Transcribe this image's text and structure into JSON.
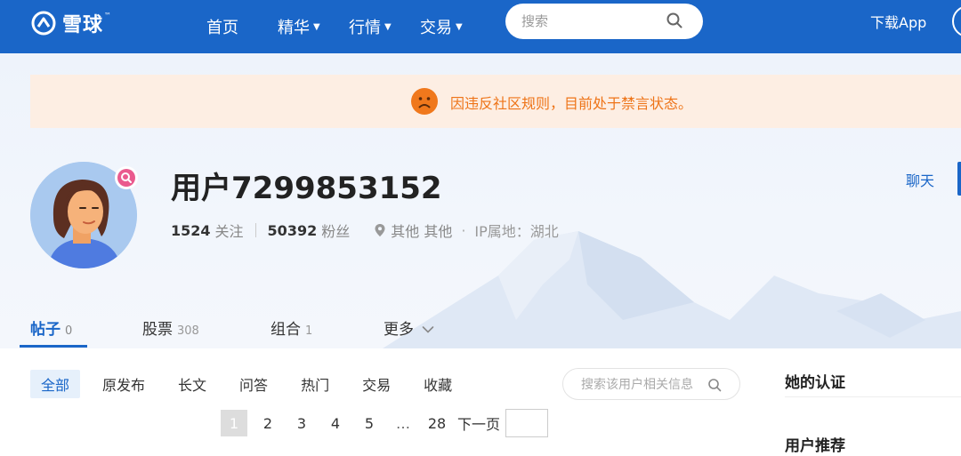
{
  "header": {
    "logo_text": "雪球",
    "logo_tm": "™",
    "nav": [
      {
        "label": "首页"
      },
      {
        "label": "精华"
      },
      {
        "label": "行情"
      },
      {
        "label": "交易"
      }
    ],
    "search_placeholder": "搜索",
    "download_label": "下载App"
  },
  "notice": {
    "text": "因违反社区规则，目前处于禁言状态。"
  },
  "profile": {
    "username": "用户7299853152",
    "following_count": "1524",
    "following_label": "关注",
    "followers_count": "50392",
    "followers_label": "粉丝",
    "location": "其他 其他",
    "ip_location": "IP属地：湖北",
    "chat_label": "聊天"
  },
  "tabs": [
    {
      "label": "帖子",
      "count": "0"
    },
    {
      "label": "股票",
      "count": "308"
    },
    {
      "label": "组合",
      "count": "1"
    },
    {
      "label": "更多",
      "count": ""
    }
  ],
  "filters": [
    "全部",
    "原发布",
    "长文",
    "问答",
    "热门",
    "交易",
    "收藏"
  ],
  "user_search_placeholder": "搜索该用户相关信息",
  "pagination": {
    "pages": [
      "1",
      "2",
      "3",
      "4",
      "5"
    ],
    "ellipsis": "…",
    "last": "28",
    "next_label": "下一页",
    "current": "1"
  },
  "sidebar": {
    "certification_title": "她的认证",
    "recommend_title": "用户推荐"
  },
  "colors": {
    "brand": "#1a66c8",
    "notice_bg": "#fdeee3",
    "notice_text": "#ee7418",
    "badge": "#ea5a8e"
  }
}
